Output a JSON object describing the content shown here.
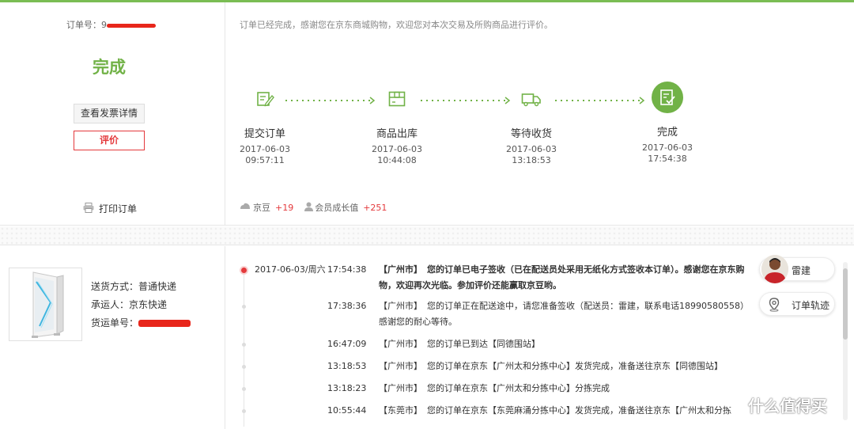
{
  "order": {
    "label": "订单号：",
    "number_visible": "9",
    "status": "完成",
    "invoice_button": "查看发票详情",
    "review_button": "评价",
    "print_label": "打印订单"
  },
  "notice": "订单已经完成，感谢您在京东商城购物，欢迎您对本次交易及所购商品进行评价。",
  "steps": [
    {
      "name": "提交订单",
      "date": "2017-06-03",
      "time": "09:57:11",
      "icon": "edit-icon"
    },
    {
      "name": "商品出库",
      "date": "2017-06-03",
      "time": "10:44:08",
      "icon": "package-icon"
    },
    {
      "name": "等待收货",
      "date": "2017-06-03",
      "time": "13:18:53",
      "icon": "truck-icon"
    },
    {
      "name": "完成",
      "date": "2017-06-03",
      "time": "17:54:38",
      "icon": "complete-icon"
    }
  ],
  "points": {
    "jingdou_label": "京豆",
    "jingdou_value": "+19",
    "growth_label": "会员成长值",
    "growth_value": "+251"
  },
  "shipping": {
    "method": "送货方式：普通快递",
    "carrier": "承运人：京东快递",
    "tracking_label": "货运单号："
  },
  "tracking": [
    {
      "date": "2017-06-03/周六",
      "time": "17:54:38",
      "city": "【广州市】",
      "msg": "您的订单已电子签收（已在配送员处采用无纸化方式签收本订单）。感谢您在京东购物，欢迎再次光临。参加评价还能赢取京豆哟。"
    },
    {
      "date": "",
      "time": "17:38:36",
      "city": "【广州市】",
      "msg": "您的订单正在配送途中，请您准备签收（配送员：雷建，联系电话18990580558）感谢您的耐心等待。"
    },
    {
      "date": "",
      "time": "16:47:09",
      "city": "【广州市】",
      "msg": "您的订单已到达【同德围站】"
    },
    {
      "date": "",
      "time": "13:18:53",
      "city": "【广州市】",
      "msg": "您的订单在京东【广州太和分拣中心】发货完成，准备送往京东【同德围站】"
    },
    {
      "date": "",
      "time": "13:18:23",
      "city": "【广州市】",
      "msg": "您的订单在京东【广州太和分拣中心】分拣完成"
    },
    {
      "date": "",
      "time": "10:55:44",
      "city": "【东莞市】",
      "msg": "您的订单在京东【东莞麻涌分拣中心】发货完成，准备送往京东【广州太和分拣"
    }
  ],
  "courier": {
    "name": "雷建",
    "track_button": "订单轨迹"
  },
  "watermark": "什么值得买",
  "colors": {
    "accent": "#71b247",
    "red": "#e4393c"
  }
}
